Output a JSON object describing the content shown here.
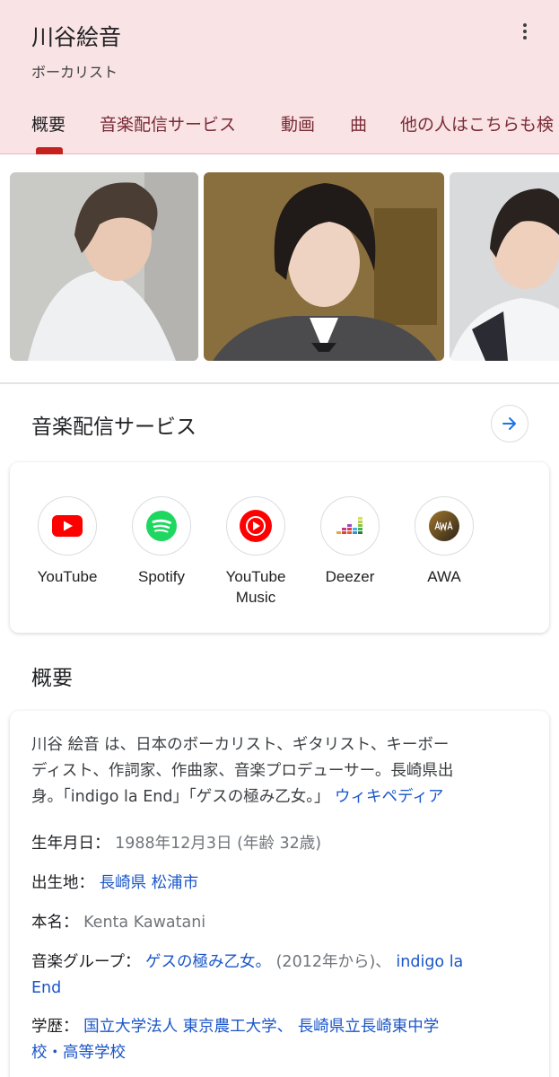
{
  "header": {
    "title": "川谷絵音",
    "subtitle": "ボーカリスト",
    "tabs": [
      "概要",
      "音楽配信サービス",
      "動画",
      "曲",
      "他の人はこちらも検"
    ]
  },
  "music_section": {
    "title": "音楽配信サービス",
    "services": [
      {
        "label": "YouTube",
        "icon": "youtube-icon"
      },
      {
        "label": "Spotify",
        "icon": "spotify-icon"
      },
      {
        "label": "YouTube Music",
        "icon": "youtube-music-icon"
      },
      {
        "label": "Deezer",
        "icon": "deezer-icon"
      },
      {
        "label": "AWA",
        "icon": "awa-icon"
      }
    ]
  },
  "overview": {
    "title": "概要",
    "desc_lines": [
      "川谷 絵音 は、日本のボーカリスト、ギタリスト、キーボー",
      "ディスト、作詞家、作曲家、音楽プロデューサー。長崎県出",
      "身。「indigo la End」「ゲスの極み乙女。」"
    ],
    "wiki_link": "ウィキペディア",
    "birth": {
      "label": "生年月日：",
      "value": "1988年12月3日 (年齢 32歳)"
    },
    "birthplace": {
      "label": "出生地：",
      "value": "長崎県 松浦市"
    },
    "realname": {
      "label": "本名：",
      "value": "Kenta Kawatani"
    },
    "group": {
      "label": "音楽グループ：",
      "link1": "ゲスの極み乙女。",
      "text": "(2012年から)、",
      "link2a": "indigo la",
      "link2b": "End"
    },
    "education": {
      "label": "学歴：",
      "link1": "国立大学法人 東京農工大学、",
      "link2a": "長崎県立長崎東中学",
      "link2b": "校・高等学校"
    }
  },
  "colors": {
    "accent": "#c5221f",
    "header_bg": "#f9e3e4",
    "link": "#1a56c9"
  }
}
